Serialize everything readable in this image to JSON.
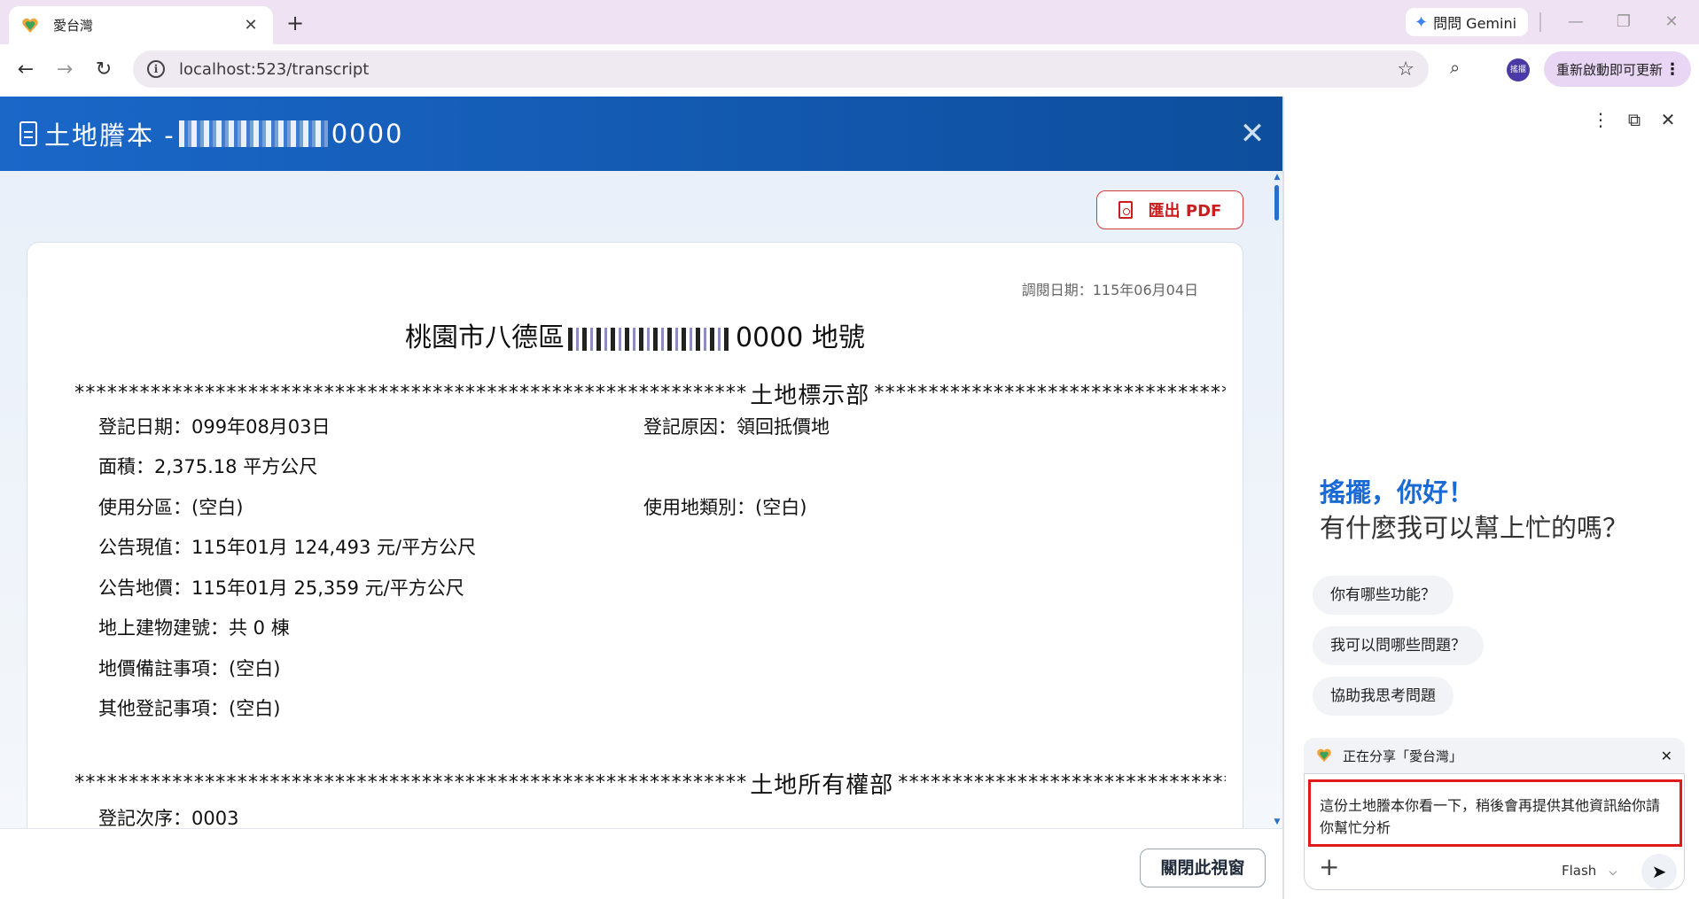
{
  "browser": {
    "tab_title": "愛台灣",
    "tab_close": "✕",
    "new_tab": "+",
    "gemini_button": "問問 Gemini",
    "url": "localhost:523/transcript",
    "profile_label": "搖擺",
    "update_button": "重新啟動即可更新"
  },
  "page": {
    "header_title": "土地謄本 - ",
    "header_suffix": "0000",
    "export_pdf": "匯出 PDF",
    "view_date": "調閱日期：115年06月04日",
    "doc_title_prefix": "桃園市八德區",
    "doc_title_suffix": "0000 地號",
    "section_marking": "土地標示部",
    "section_ownership": "土地所有權部",
    "stars_left": "**************************************************************",
    "stars_right": "********************************************",
    "fields": {
      "reg_date": "登記日期：099年08月03日",
      "reg_reason": "登記原因：領回抵價地",
      "area": "面積：2,375.18 平方公尺",
      "zoning": "使用分區：(空白)",
      "land_use_type": "使用地類別：(空白)",
      "announced_value": "公告現值：115年01月 124,493 元/平方公尺",
      "announced_price": "公告地價：115年01月 25,359 元/平方公尺",
      "building_no": "地上建物建號：共 0 棟",
      "price_note": "地價備註事項：(空白)",
      "other_reg": "其他登記事項：(空白)",
      "reg_order": "登記次序：0003"
    },
    "close_window": "關閉此視窗"
  },
  "gemini": {
    "greeting_name": "搖擺，你好！",
    "greeting_question": "有什麼我可以幫上忙的嗎？",
    "suggestions": [
      "你有哪些功能？",
      "我可以問哪些問題？",
      "協助我思考問題"
    ],
    "sharing_label": "正在分享「愛台灣」",
    "input_text": "這份土地謄本你看一下，稍後會再提供其他資訊給你請你幫忙分析",
    "model": "Flash"
  }
}
